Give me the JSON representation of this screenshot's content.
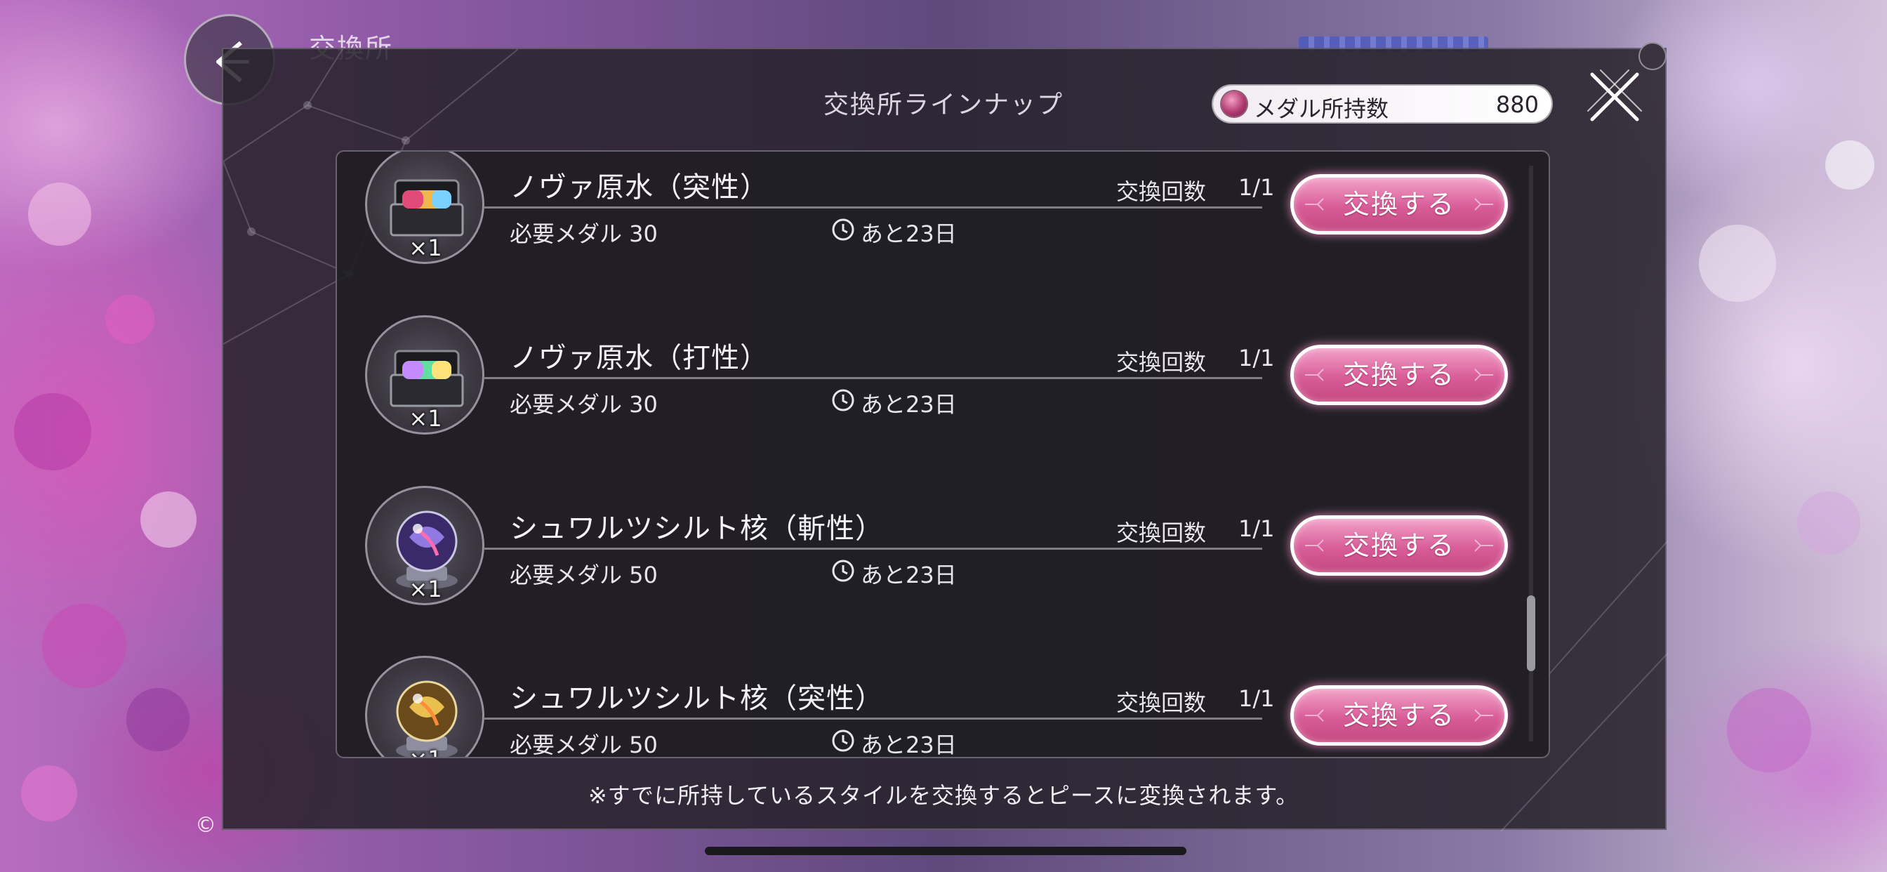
{
  "background": {
    "screen_title": "交換所",
    "copyright_mark": "©"
  },
  "header": {
    "title": "交換所ラインナップ",
    "medal_label": "メダル所持数",
    "medal_count": "880",
    "close_icon": "close-x-icon",
    "back_icon": "back-arrow-icon"
  },
  "colors": {
    "accent": "#d85d98",
    "panel": "#26222a",
    "text": "#f4f2f6"
  },
  "items": [
    {
      "name": "ノヴァ原水（突性）",
      "quantity": "×1",
      "cost": "必要メダル 30",
      "time_left": "あと23日",
      "limit_label": "交換回数",
      "limit": "1/1",
      "button": "交換する",
      "icon": "nova-water-case-icon"
    },
    {
      "name": "ノヴァ原水（打性）",
      "quantity": "×1",
      "cost": "必要メダル 30",
      "time_left": "あと23日",
      "limit_label": "交換回数",
      "limit": "1/1",
      "button": "交換する",
      "icon": "nova-water-case-icon"
    },
    {
      "name": "シュワルツシルト核（斬性）",
      "quantity": "×1",
      "cost": "必要メダル 50",
      "time_left": "あと23日",
      "limit_label": "交換回数",
      "limit": "1/1",
      "button": "交換する",
      "icon": "schwarzschild-core-orb-icon"
    },
    {
      "name": "シュワルツシルト核（突性）",
      "quantity": "×1",
      "cost": "必要メダル 50",
      "time_left": "あと23日",
      "limit_label": "交換回数",
      "limit": "1/1",
      "button": "交換する",
      "icon": "schwarzschild-core-orb-icon"
    }
  ],
  "footer": {
    "note": "※すでに所持しているスタイルを交換するとピースに変換されます。"
  }
}
